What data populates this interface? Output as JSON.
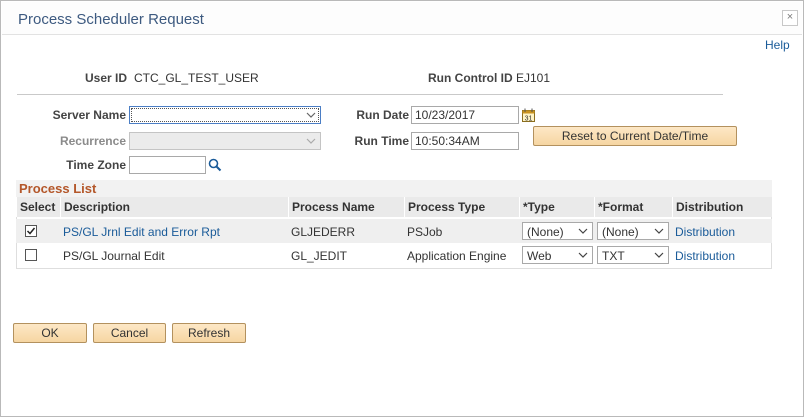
{
  "window": {
    "title": "Process Scheduler Request",
    "close_glyph": "×",
    "help_label": "Help"
  },
  "header": {
    "user_id_label": "User ID",
    "user_id_value": "CTC_GL_TEST_USER",
    "run_control_label": "Run Control ID",
    "run_control_value": "EJ101"
  },
  "form": {
    "server_name_label": "Server Name",
    "server_name_value": "",
    "recurrence_label": "Recurrence",
    "recurrence_value": "",
    "time_zone_label": "Time Zone",
    "time_zone_value": "",
    "run_date_label": "Run Date",
    "run_date_value": "10/23/2017",
    "run_time_label": "Run Time",
    "run_time_value": "10:50:34AM",
    "reset_button_label": "Reset to Current Date/Time",
    "icons": {
      "calendar": "calendar-icon",
      "search": "search-icon"
    }
  },
  "process_list": {
    "title": "Process List",
    "columns": [
      "Select",
      "Description",
      "Process Name",
      "Process Type",
      "*Type",
      "*Format",
      "Distribution"
    ],
    "rows": [
      {
        "selected": true,
        "description": "PS/GL Jrnl Edit and Error Rpt",
        "process_name": "GLJEDERR",
        "process_type": "PSJob",
        "type": "(None)",
        "format": "(None)",
        "distribution": "Distribution"
      },
      {
        "selected": false,
        "description": "PS/GL Journal Edit",
        "process_name": "GL_JEDIT",
        "process_type": "Application Engine",
        "type": "Web",
        "format": "TXT",
        "distribution": "Distribution"
      }
    ]
  },
  "footer": {
    "ok_label": "OK",
    "cancel_label": "Cancel",
    "refresh_label": "Refresh"
  },
  "colors": {
    "title": "#3d5a80",
    "link": "#1a5b99",
    "section_title": "#b4572a",
    "button_fill": "#f6d6a2"
  }
}
